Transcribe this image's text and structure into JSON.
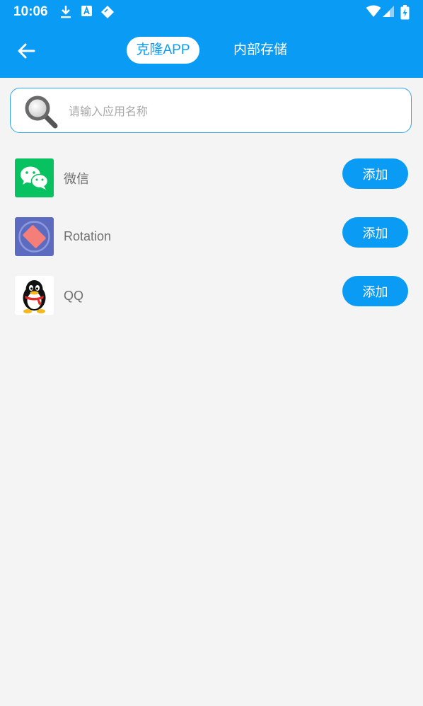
{
  "status_bar": {
    "time": "10:06",
    "notification_icons": [
      "download-icon",
      "font-app-icon",
      "tag-icon"
    ],
    "system_icons": [
      "wifi-icon",
      "signal-icon",
      "battery-charging-icon"
    ]
  },
  "app_bar": {
    "back_icon": "arrow-left-icon",
    "tabs": [
      {
        "label": "克隆APP",
        "active": true
      },
      {
        "label": "内部存储",
        "active": false
      }
    ]
  },
  "search": {
    "icon": "magnifier-icon",
    "placeholder": "请输入应用名称",
    "value": ""
  },
  "apps": [
    {
      "name": "微信",
      "icon": "wechat-icon",
      "button": "添加"
    },
    {
      "name": "Rotation",
      "icon": "rotation-icon",
      "button": "添加"
    },
    {
      "name": "QQ",
      "icon": "qq-icon",
      "button": "添加"
    }
  ],
  "colors": {
    "primary": "#0a9cf5",
    "background": "#f4f4f4"
  }
}
